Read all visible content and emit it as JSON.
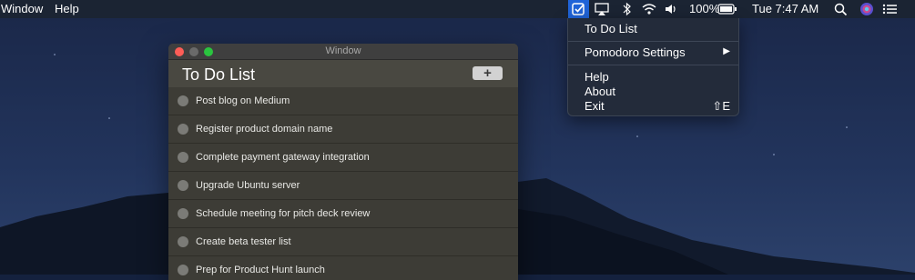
{
  "menubar": {
    "menus": [
      "Window",
      "Help"
    ],
    "battery": "100%",
    "clock": "Tue 7:47 AM",
    "icons": [
      "todo-checkmark-icon",
      "airplay-icon",
      "bluetooth-icon",
      "wifi-icon",
      "volume-icon",
      "battery-icon",
      "spotlight-search-icon",
      "siri-icon",
      "notification-center-icon"
    ]
  },
  "dropdown": {
    "todo": "To Do List",
    "pomodoro": "Pomodoro Settings",
    "help": "Help",
    "about": "About",
    "exit": "Exit",
    "exit_shortcut": "⇧E"
  },
  "window": {
    "title": "Window",
    "app_title": "To Do List",
    "add_label": "+",
    "tasks": [
      "Post blog on Medium",
      "Register product domain name",
      "Complete payment gateway integration",
      "Upgrade Ubuntu server",
      "Schedule meeting for pitch deck review",
      "Create beta tester list",
      "Prep for Product Hunt launch"
    ]
  },
  "colors": {
    "accent": "#1f63d8",
    "window_bg": "#3d3c36",
    "menubar_bg": "#1b2433"
  }
}
